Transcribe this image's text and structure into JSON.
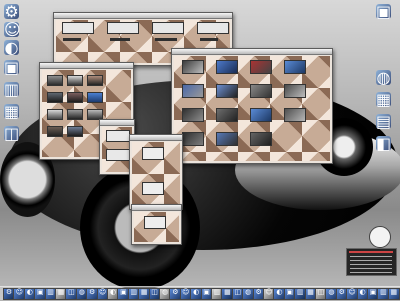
{
  "desktop": {
    "caption": "",
    "calendar_caption": ""
  },
  "dock": {
    "count": 38
  },
  "colors": {
    "wallpaper": "#a8a8a8",
    "window_fill": "#d9c1ad",
    "accent_blue": "#4d79c9"
  },
  "icons": [
    "gear-icon",
    "person-icon",
    "apple-icon",
    "folder-icon",
    "window-icon",
    "grid-icon",
    "box-icon",
    "globe-icon",
    "calendar-icon"
  ]
}
